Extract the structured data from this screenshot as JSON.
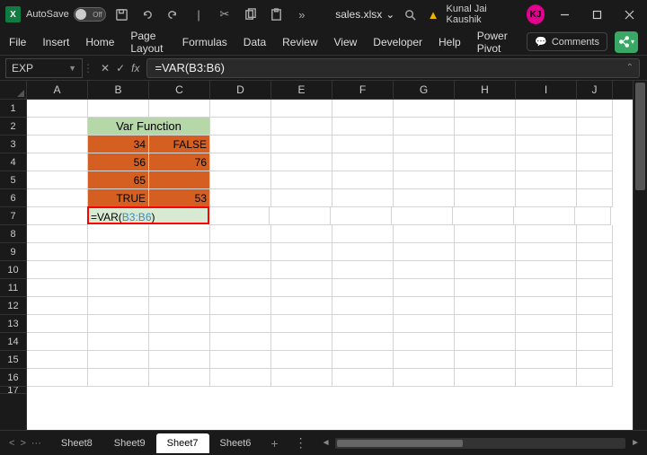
{
  "title": {
    "autosave_label": "AutoSave",
    "toggle_state": "Off",
    "filename": "sales.xlsx",
    "user_name": "Kunal Jai Kaushik",
    "user_initials": "KJ"
  },
  "ribbon": {
    "tabs": [
      "File",
      "Insert",
      "Home",
      "Page Layout",
      "Formulas",
      "Data",
      "Review",
      "View",
      "Developer",
      "Help",
      "Power Pivot"
    ],
    "comments_label": "Comments"
  },
  "formula": {
    "namebox": "EXP",
    "bar_prefix": "=VAR(",
    "bar_ref": "B3:B6",
    "bar_suffix": ")"
  },
  "columns": [
    "A",
    "B",
    "C",
    "D",
    "E",
    "F",
    "G",
    "H",
    "I",
    "J"
  ],
  "rows": [
    "1",
    "2",
    "3",
    "4",
    "5",
    "6",
    "7",
    "8",
    "9",
    "10",
    "11",
    "12",
    "13",
    "14",
    "15",
    "16",
    "17"
  ],
  "cells": {
    "header": "Var Function",
    "b3": "34",
    "c3": "FALSE",
    "b4": "56",
    "c4": "76",
    "b5": "65",
    "c5": "",
    "b6": "TRUE",
    "c6": "53",
    "b7_prefix": "=VAR(",
    "b7_ref": "B3:B6",
    "b7_suffix": ")"
  },
  "tabs": {
    "sheets": [
      "Sheet8",
      "Sheet9",
      "Sheet7",
      "Sheet6"
    ],
    "active": "Sheet7"
  }
}
